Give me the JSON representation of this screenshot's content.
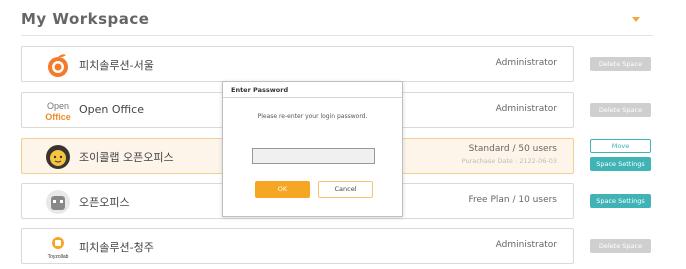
{
  "header": {
    "title": "My Workspace"
  },
  "workspaces": [
    {
      "name": "피치솔루션-서울",
      "plan": "Administrator",
      "button": "Delete Space"
    },
    {
      "name": "Open Office",
      "plan": "Administrator",
      "button": "Delete Space",
      "logo_text_top": "Open",
      "logo_text_bottom": "Office"
    },
    {
      "name": "조이콜랩 오픈오피스",
      "plan": "Standard / 50 users",
      "sub": "Purachase Date : 2122-06-03",
      "button_move": "Move",
      "button_settings": "Space Settings"
    },
    {
      "name": "오픈오피스",
      "plan": "Free Plan / 10 users",
      "button": "Space Settings"
    },
    {
      "name": "피치솔루션-청주",
      "plan": "Administrator",
      "button": "Delete Space",
      "logo_text": "Toyzollab"
    }
  ],
  "dialog": {
    "title": "Enter Password",
    "message": "Please re-enter your login password.",
    "input_value": "",
    "ok_label": "OK",
    "cancel_label": "Cancel"
  },
  "colors": {
    "accent": "#f5a623",
    "teal": "#3fb3b5",
    "disabled": "#cfcfcf",
    "active_bg": "#fdf5ea"
  }
}
